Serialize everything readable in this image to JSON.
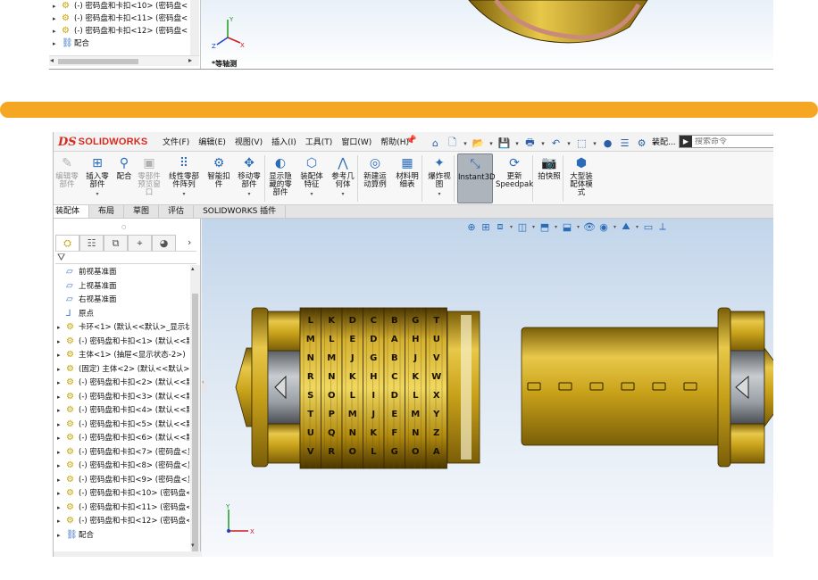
{
  "top_screenshot": {
    "tree_items": [
      {
        "arrow": "▸",
        "icon": "part-icon",
        "label": "(-) 密码盘和卡扣<10> (密码盘<"
      },
      {
        "arrow": "▸",
        "icon": "part-icon",
        "label": "(-) 密码盘和卡扣<11> (密码盘<"
      },
      {
        "arrow": "▸",
        "icon": "part-icon",
        "label": "(-) 密码盘和卡扣<12> (密码盘<"
      },
      {
        "arrow": "▸",
        "icon": "mate-icon",
        "label": "配合"
      }
    ],
    "view_label": "*等轴测",
    "colors": {
      "tree_bg": "#ffffff",
      "view_top": "#e8f0f8"
    }
  },
  "divider": {
    "color": "#f5a623"
  },
  "app": {
    "logo_mark": "DS",
    "logo_name": "SOLIDWORKS",
    "menu": [
      "文件(F)",
      "编辑(E)",
      "视图(V)",
      "插入(I)",
      "工具(T)",
      "窗口(W)",
      "帮助(H)"
    ],
    "quick_toolbar": [
      "home-icon",
      "new-file-icon",
      "open-icon",
      "save-icon",
      "print-icon",
      "undo-icon",
      "select-icon",
      "traffic-light-icon",
      "file-properties-icon",
      "options-icon"
    ],
    "assembly_trunc": "装配...",
    "search_placeholder": "搜索命令",
    "ribbon": [
      {
        "id": "edit-component",
        "label": "编辑零\n部件",
        "disabled": true,
        "icon": "✎"
      },
      {
        "id": "insert-component",
        "label": "插入零\n部件",
        "disabled": false,
        "icon": "⊞",
        "drop": true
      },
      {
        "id": "mate",
        "label": "配合",
        "disabled": false,
        "icon": "⚲"
      },
      {
        "id": "component-preview",
        "label": "零部件\n预览窗\n口",
        "disabled": true,
        "icon": "▣"
      },
      {
        "id": "linear-pattern",
        "label": "线性零部\n件阵列",
        "disabled": false,
        "icon": "⠿",
        "drop": true
      },
      {
        "id": "smart-fasteners",
        "label": "智能扣\n件",
        "disabled": false,
        "icon": "⚙"
      },
      {
        "id": "move-component",
        "label": "移动零\n部件",
        "disabled": false,
        "icon": "✥",
        "drop": true
      },
      {
        "id": "show-hidden",
        "label": "显示隐\n藏的零\n部件",
        "disabled": false,
        "icon": "◐"
      },
      {
        "id": "assembly-features",
        "label": "装配体\n特征",
        "disabled": false,
        "icon": "⬡",
        "drop": true
      },
      {
        "id": "reference-geometry",
        "label": "参考几\n何体",
        "disabled": false,
        "icon": "⋀",
        "drop": true
      },
      {
        "id": "new-motion-study",
        "label": "新建运\n动算例",
        "disabled": false,
        "icon": "◎"
      },
      {
        "id": "bill-of-materials",
        "label": "材料明\n细表",
        "disabled": false,
        "icon": "▦"
      },
      {
        "id": "exploded-view",
        "label": "爆炸视\n图",
        "disabled": false,
        "icon": "✦",
        "drop": true
      },
      {
        "id": "instant3d",
        "label": "Instant3D",
        "disabled": false,
        "icon": "⤡",
        "active": true
      },
      {
        "id": "update-speedpak",
        "label": "更新\nSpeedpak",
        "disabled": false,
        "icon": "⟳"
      },
      {
        "id": "snapshot",
        "label": "拍快照",
        "disabled": false,
        "icon": "📷"
      },
      {
        "id": "large-assembly-mode",
        "label": "大型装\n配体模\n式",
        "disabled": false,
        "icon": "⬢"
      }
    ],
    "tabs": [
      "装配体",
      "布局",
      "草图",
      "评估",
      "SOLIDWORKS 插件"
    ],
    "active_tab": "装配体",
    "fm_tabs": [
      "feature-manager-tab-icon",
      "property-manager-tab-icon",
      "configuration-manager-tab-icon",
      "dimxpert-tab-icon",
      "display-manager-tab-icon"
    ],
    "tree": [
      {
        "arrow": "",
        "icon": "plane-icon",
        "label": "前视基准面"
      },
      {
        "arrow": "",
        "icon": "plane-icon",
        "label": "上视基准面"
      },
      {
        "arrow": "",
        "icon": "plane-icon",
        "label": "右视基准面"
      },
      {
        "arrow": "",
        "icon": "origin-icon",
        "label": "原点"
      },
      {
        "arrow": "▸",
        "icon": "part-icon",
        "label": "卡环<1> (默认<<默认>_显示状"
      },
      {
        "arrow": "▸",
        "icon": "part-icon",
        "label": "(-) 密码盘和卡扣<1> (默认<<默"
      },
      {
        "arrow": "▸",
        "icon": "part-icon",
        "label": "主体<1> (抽屉<显示状态-2>)"
      },
      {
        "arrow": "▸",
        "icon": "part-icon",
        "label": "(固定) 主体<2> (默认<<默认>_"
      },
      {
        "arrow": "▸",
        "icon": "part-icon",
        "label": "(-) 密码盘和卡扣<2> (默认<<默"
      },
      {
        "arrow": "▸",
        "icon": "part-icon",
        "label": "(-) 密码盘和卡扣<3> (默认<<默"
      },
      {
        "arrow": "▸",
        "icon": "part-icon",
        "label": "(-) 密码盘和卡扣<4> (默认<<默"
      },
      {
        "arrow": "▸",
        "icon": "part-icon",
        "label": "(-) 密码盘和卡扣<5> (默认<<默"
      },
      {
        "arrow": "▸",
        "icon": "part-icon",
        "label": "(-) 密码盘和卡扣<6> (默认<<默"
      },
      {
        "arrow": "▸",
        "icon": "part-icon",
        "label": "(-) 密码盘和卡扣<7> (密码盘<显"
      },
      {
        "arrow": "▸",
        "icon": "part-icon",
        "label": "(-) 密码盘和卡扣<8> (密码盘<显"
      },
      {
        "arrow": "▸",
        "icon": "part-icon",
        "label": "(-) 密码盘和卡扣<9> (密码盘<显"
      },
      {
        "arrow": "▸",
        "icon": "part-icon",
        "label": "(-) 密码盘和卡扣<10> (密码盘<"
      },
      {
        "arrow": "▸",
        "icon": "part-icon",
        "label": "(-) 密码盘和卡扣<11> (密码盘<"
      },
      {
        "arrow": "▸",
        "icon": "part-icon",
        "label": "(-) 密码盘和卡扣<12> (密码盘<"
      },
      {
        "arrow": "▸",
        "icon": "mate-icon",
        "label": "配合"
      }
    ],
    "view_toolbar": [
      "zoom-to-fit-icon",
      "zoom-area-icon",
      "previous-view-icon",
      "section-view-icon",
      "view-orientation-icon",
      "display-style-icon",
      "hide-show-icon",
      "edit-appearance-icon",
      "apply-scene-icon",
      "view-settings-icon",
      "display-pane-icon"
    ],
    "model": {
      "dial_letters": [
        [
          "L",
          "K",
          "D",
          "C",
          "B",
          "G",
          "T"
        ],
        [
          "M",
          "L",
          "E",
          "D",
          "A",
          "H",
          "U"
        ],
        [
          "N",
          "M",
          "J",
          "G",
          "B",
          "J",
          "V"
        ],
        [
          "R",
          "N",
          "K",
          "H",
          "C",
          "K",
          "W"
        ],
        [
          "S",
          "O",
          "L",
          "I",
          "D",
          "L",
          "X"
        ],
        [
          "T",
          "P",
          "M",
          "J",
          "E",
          "M",
          "Y"
        ],
        [
          "U",
          "Q",
          "N",
          "K",
          "F",
          "N",
          "Z"
        ],
        [
          "V",
          "R",
          "O",
          "L",
          "G",
          "O",
          "A"
        ]
      ],
      "colors": {
        "gold": "#c9a21a",
        "gold_light": "#e8c84a",
        "gold_dark": "#7a5e08",
        "steel": "#9aa0a6"
      }
    },
    "triad": {
      "x": "X",
      "y": "Y",
      "z": "Z"
    }
  }
}
